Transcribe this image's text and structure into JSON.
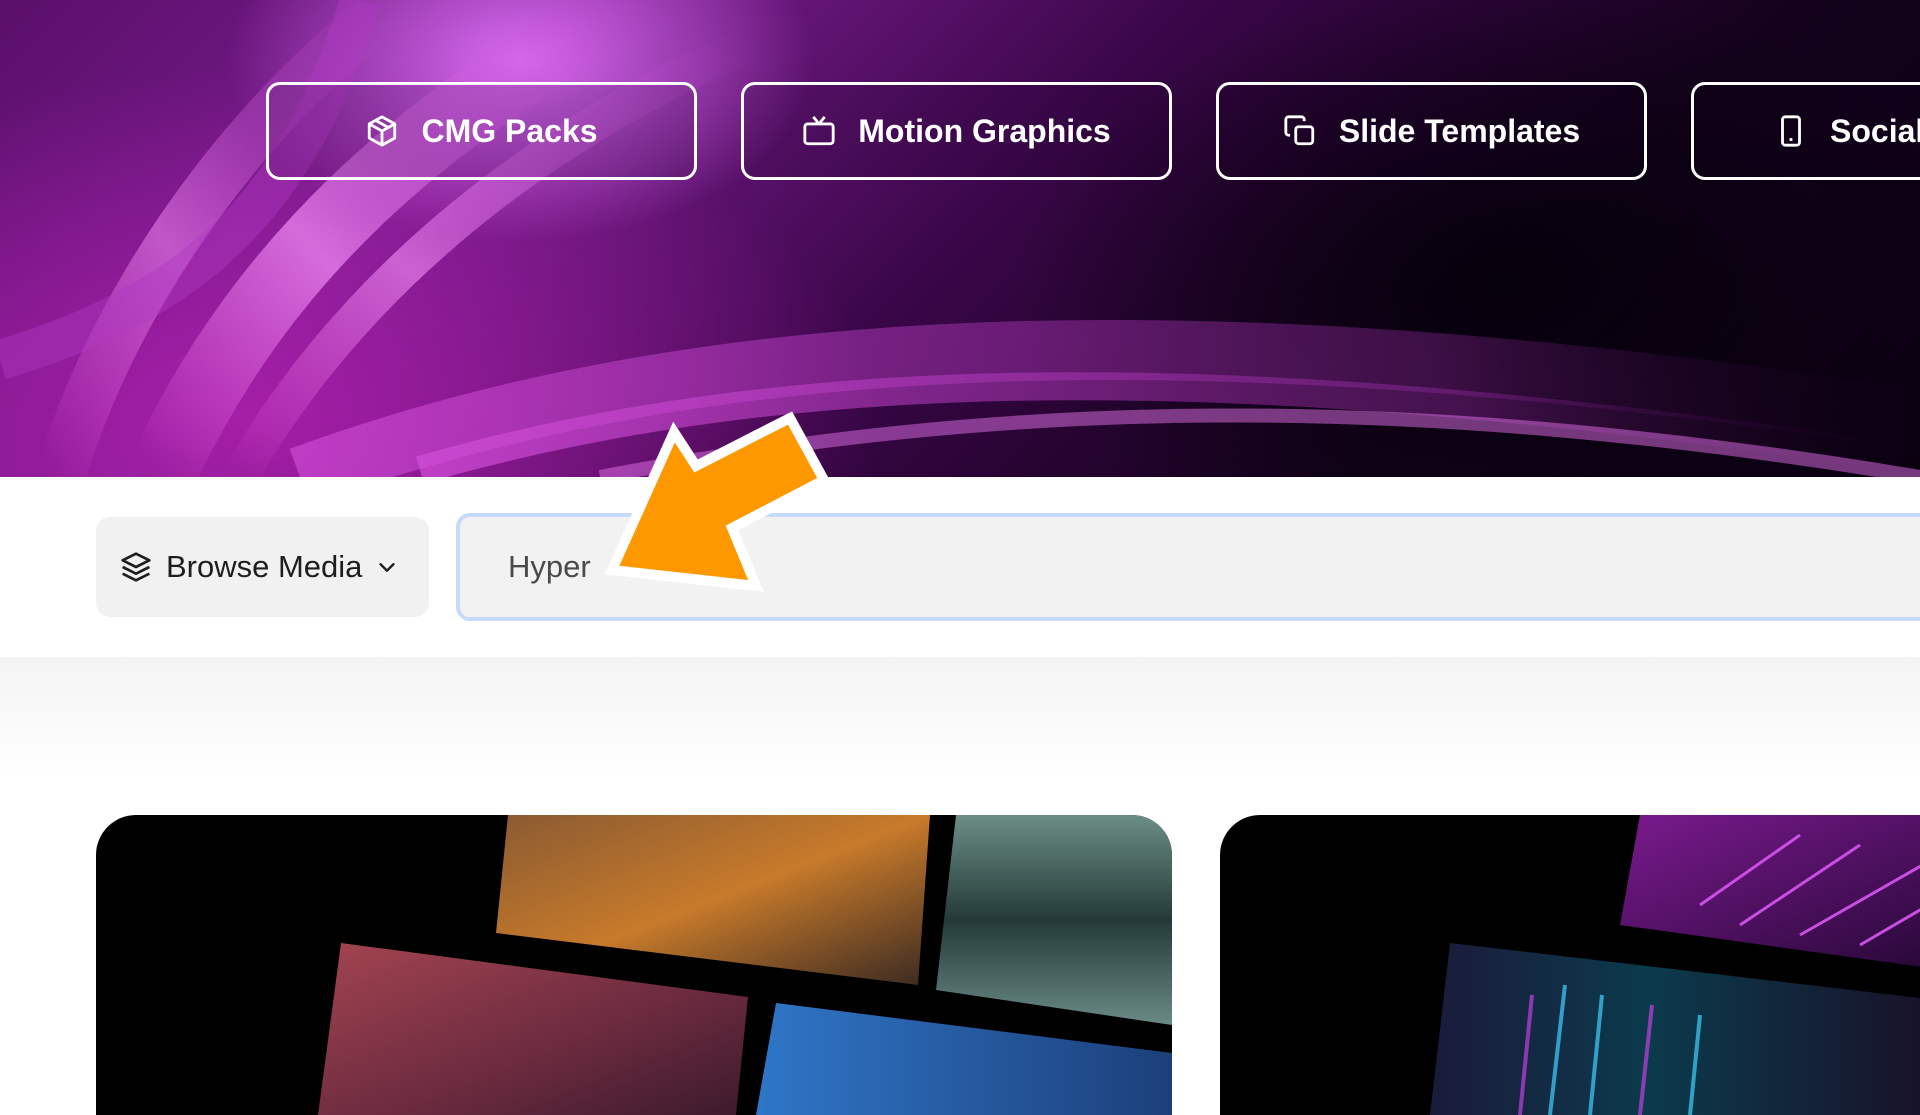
{
  "nav": {
    "items": [
      {
        "label": "CMG Packs",
        "icon": "package-icon"
      },
      {
        "label": "Motion Graphics",
        "icon": "tv-icon"
      },
      {
        "label": "Slide Templates",
        "icon": "copy-icon"
      },
      {
        "label": "Social",
        "icon": "phone-icon"
      }
    ]
  },
  "browse": {
    "label": "Browse Media",
    "icon": "layers-icon",
    "chevron": "chevron-down-icon"
  },
  "search": {
    "value": "Hyper"
  },
  "colors": {
    "hero_purple": "#7a1d8f",
    "hero_dark": "#0a0010",
    "nav_border": "#ffffff",
    "search_focus": "#c6dbfb",
    "arrow_orange": "#fe9800"
  },
  "cards": [
    {
      "name": "collage-card-landscapes"
    },
    {
      "name": "collage-card-neon"
    }
  ]
}
